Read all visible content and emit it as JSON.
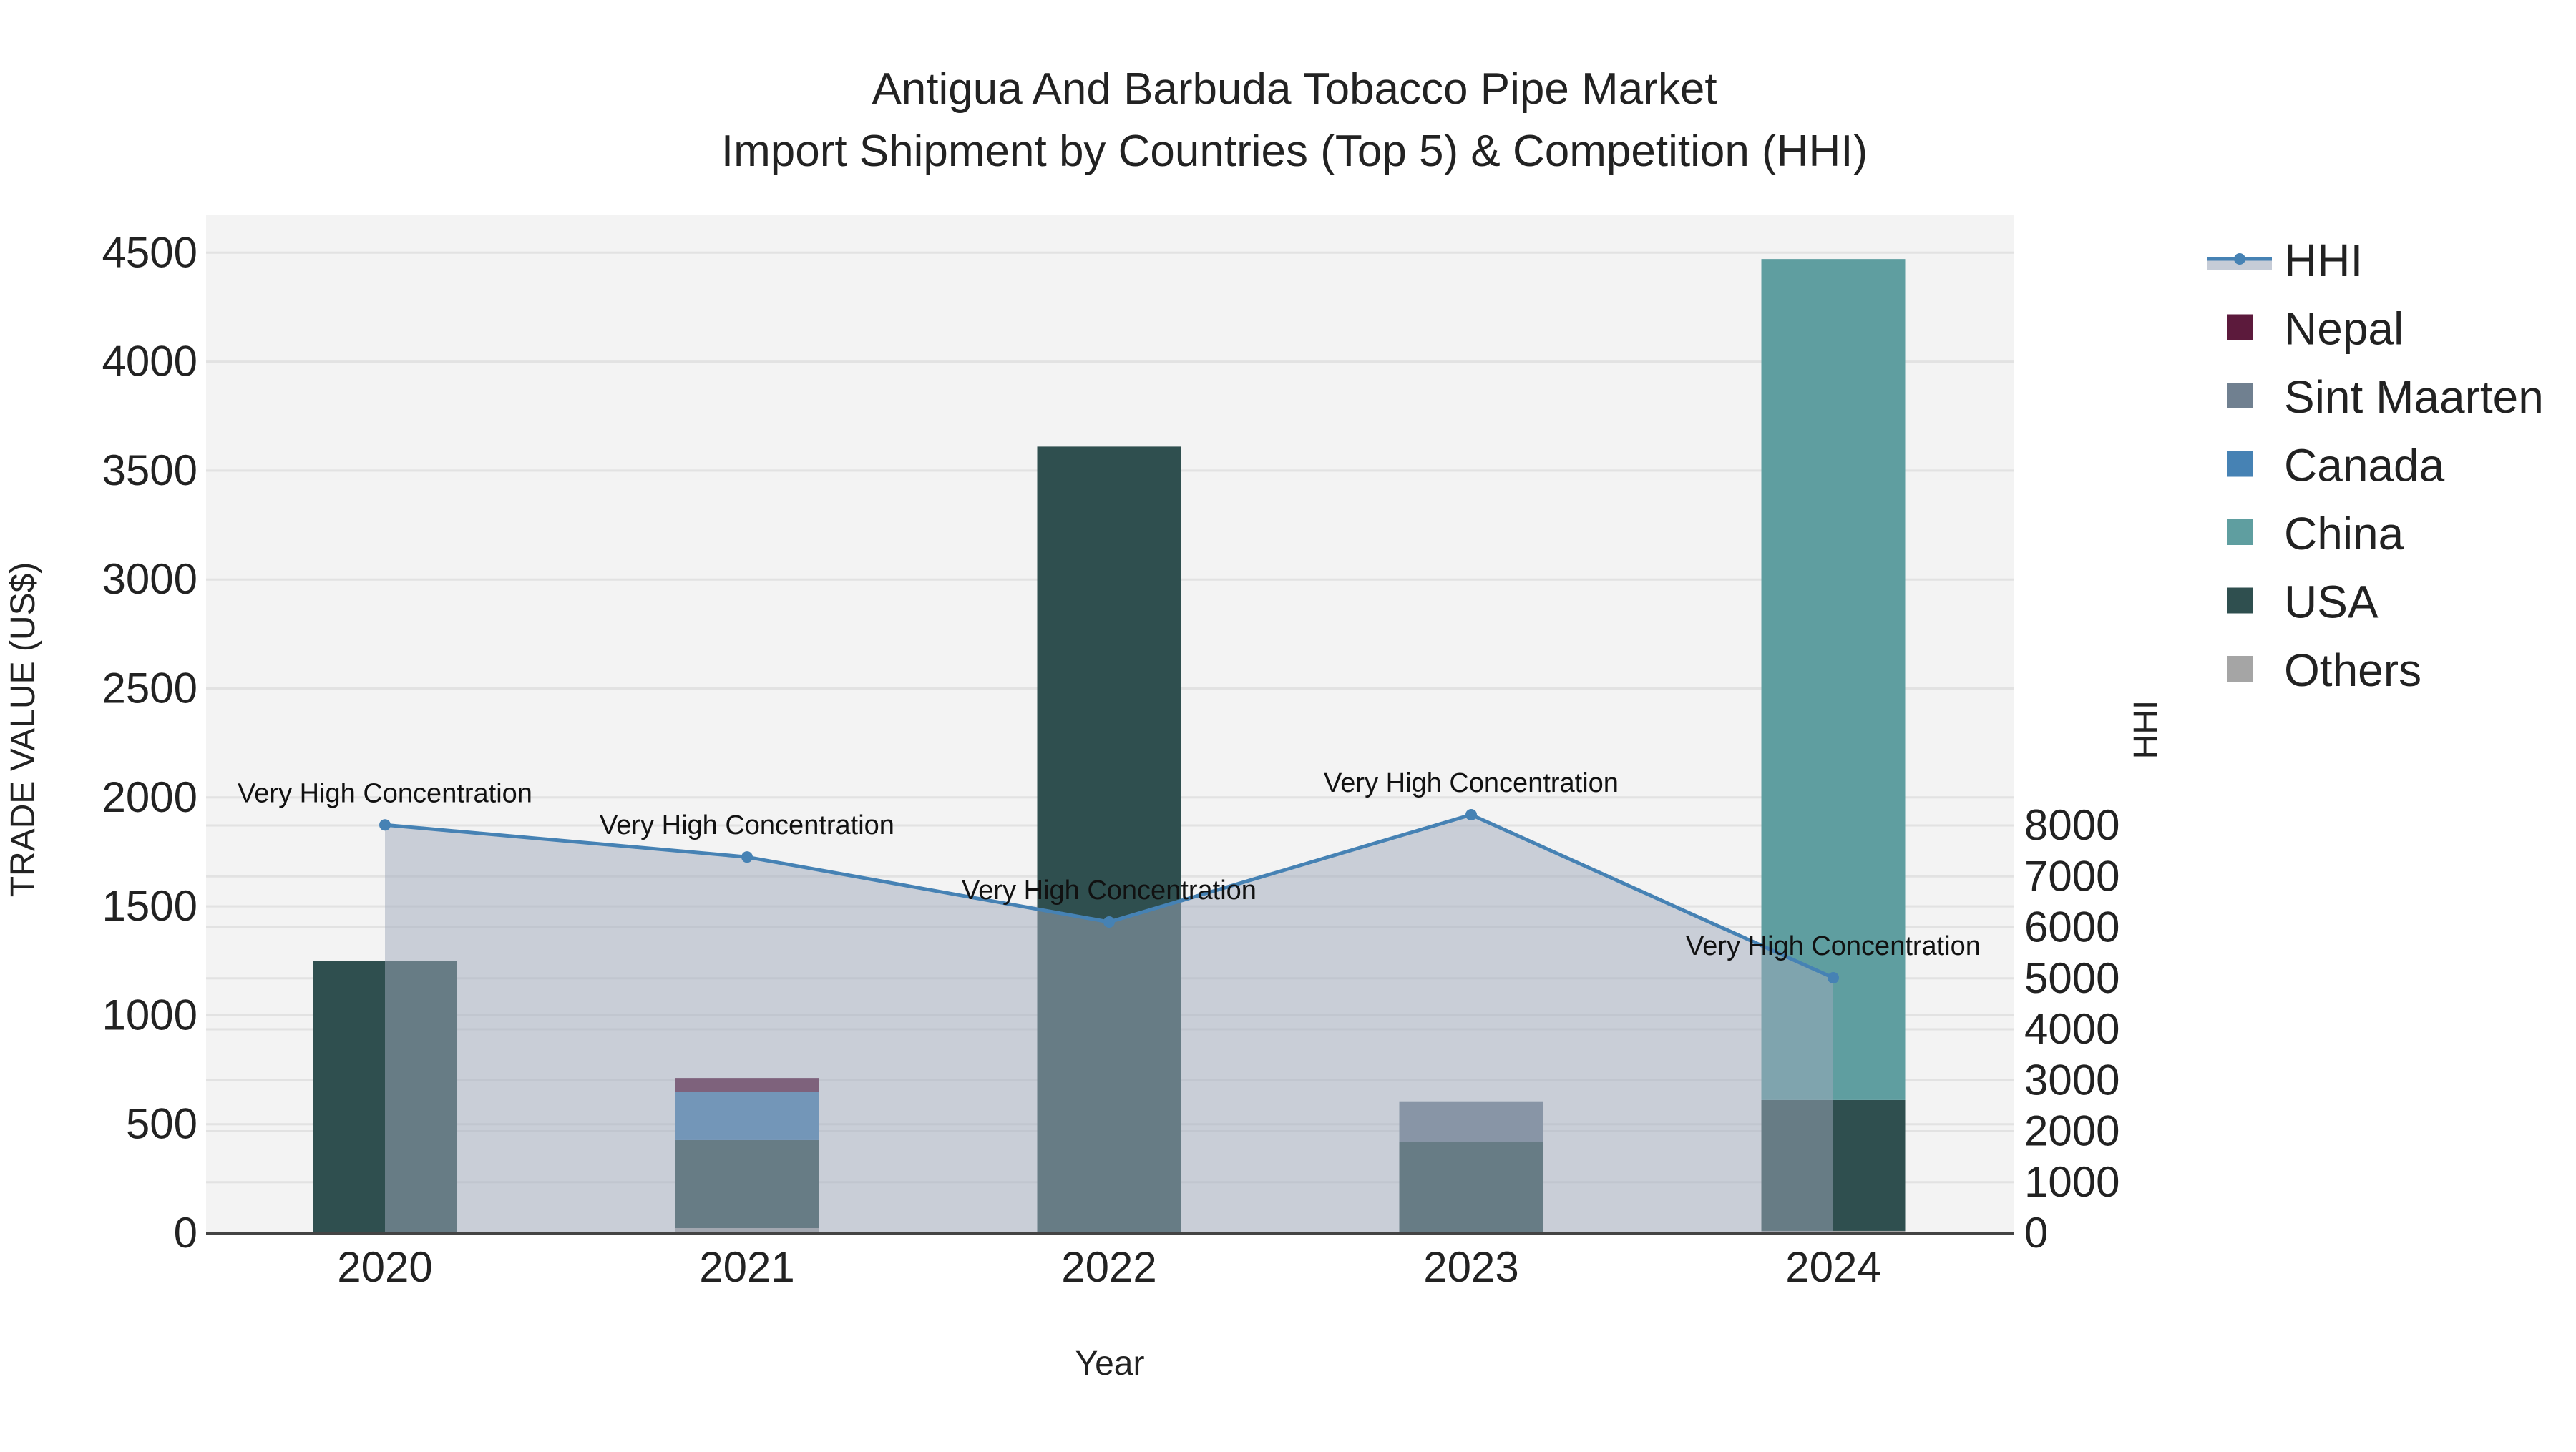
{
  "chart_data": {
    "type": "bar",
    "title": "Antigua And Barbuda Tobacco Pipe Market",
    "subtitle": "Import Shipment by Countries (Top 5) & Competition (HHI)",
    "xlabel": "Year",
    "ylabel": "TRADE VALUE (US$)",
    "y2label": "HHI",
    "categories": [
      "2020",
      "2021",
      "2022",
      "2023",
      "2024"
    ],
    "ylim": [
      0,
      4700
    ],
    "y2lim": [
      0,
      8700
    ],
    "yticks": [
      0,
      500,
      1000,
      1500,
      2000,
      2500,
      3000,
      3500,
      4000,
      4500
    ],
    "y2ticks": [
      0,
      1000,
      2000,
      3000,
      4000,
      5000,
      6000,
      7000,
      8000
    ],
    "stacked": true,
    "series": [
      {
        "name": "Others",
        "color": "#a5a5a5",
        "values": [
          0,
          23,
          0,
          0,
          10
        ]
      },
      {
        "name": "USA",
        "color": "#2f4f4f",
        "values": [
          1250,
          404,
          3610,
          420,
          601
        ]
      },
      {
        "name": "China",
        "color": "#5f9ea0",
        "values": [
          0,
          0,
          0,
          0,
          3860
        ]
      },
      {
        "name": "Canada",
        "color": "#4682b4",
        "values": [
          0,
          220,
          0,
          0,
          0
        ]
      },
      {
        "name": "Sint Maarten",
        "color": "#708090",
        "values": [
          0,
          0,
          0,
          185,
          0
        ]
      },
      {
        "name": "Nepal",
        "color": "#5c1a3c",
        "values": [
          0,
          65,
          0,
          0,
          0
        ]
      }
    ],
    "hhi": {
      "name": "HHI",
      "color": "#4682b4",
      "values": [
        8010,
        7380,
        6105,
        8210,
        5010
      ],
      "annotations": [
        "Very High Concentration",
        "Very High Concentration",
        "Very High Concentration",
        "Very High Concentration",
        "Very High Concentration"
      ]
    },
    "legend": {
      "placement": "top-right",
      "order": [
        "HHI",
        "Nepal",
        "Sint Maarten",
        "Canada",
        "China",
        "USA",
        "Others"
      ]
    },
    "grid": true
  }
}
